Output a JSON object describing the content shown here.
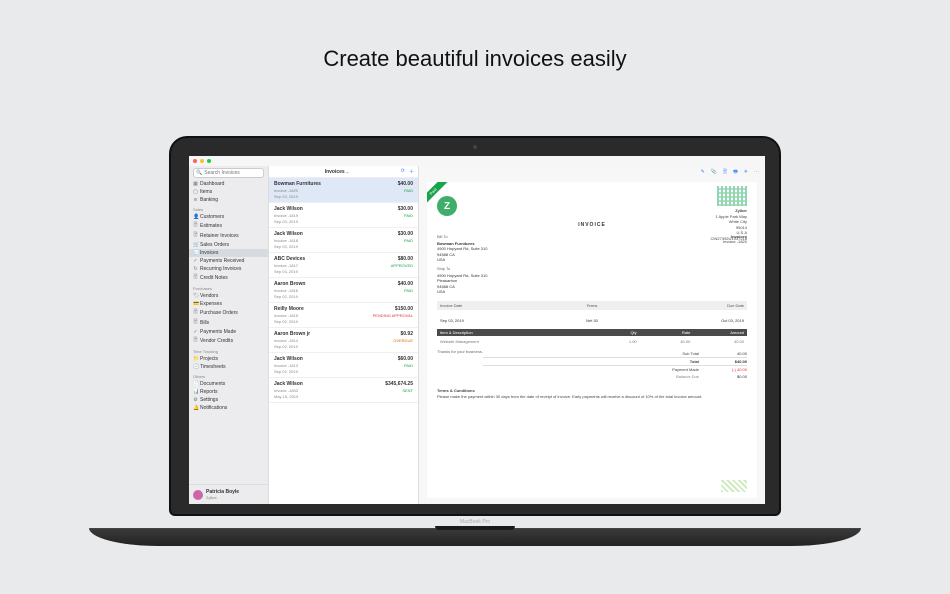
{
  "headline": "Create beautiful invoices easily",
  "laptop_label": "MacBook Pro",
  "search": {
    "placeholder": "Search Invoices"
  },
  "sidebar": {
    "top": [
      {
        "icon": "▦",
        "label": "Dashboard"
      },
      {
        "icon": "▢",
        "label": "Items"
      },
      {
        "icon": "≋",
        "label": "Banking"
      }
    ],
    "sections": [
      {
        "title": "Sales",
        "items": [
          {
            "icon": "👤",
            "label": "Customers"
          },
          {
            "icon": "🗎",
            "label": "Estimates"
          },
          {
            "icon": "🗎",
            "label": "Retainer Invoices"
          },
          {
            "icon": "🛒",
            "label": "Sales Orders"
          },
          {
            "icon": "🧾",
            "label": "Invoices",
            "active": true
          },
          {
            "icon": "✓",
            "label": "Payments Received"
          },
          {
            "icon": "↻",
            "label": "Recurring Invoices"
          },
          {
            "icon": "🗎",
            "label": "Credit Notes"
          }
        ]
      },
      {
        "title": "Purchases",
        "items": [
          {
            "icon": "🏷",
            "label": "Vendors"
          },
          {
            "icon": "💳",
            "label": "Expenses"
          },
          {
            "icon": "🗎",
            "label": "Purchase Orders"
          },
          {
            "icon": "🗎",
            "label": "Bills"
          },
          {
            "icon": "✓",
            "label": "Payments Made"
          },
          {
            "icon": "🗎",
            "label": "Vendor Credits"
          }
        ]
      },
      {
        "title": "Time Tracking",
        "items": [
          {
            "icon": "📁",
            "label": "Projects"
          },
          {
            "icon": "🕘",
            "label": "Timesheets"
          }
        ]
      },
      {
        "title": "Others",
        "items": [
          {
            "icon": "📄",
            "label": "Documents"
          },
          {
            "icon": "📊",
            "label": "Reports"
          },
          {
            "icon": "⚙",
            "label": "Settings"
          },
          {
            "icon": "🔔",
            "label": "Notifications"
          }
        ]
      }
    ],
    "profile": {
      "name": "Patricia Boyle",
      "org": "Zylker"
    }
  },
  "list": {
    "title": "Invoices",
    "rows": [
      {
        "name": "Bowman Furnitures",
        "amount": "$40.00",
        "num": "Invoice -1820",
        "status": "PAID",
        "date": "Sep 03, 2019",
        "selected": true
      },
      {
        "name": "Jack Wilson",
        "amount": "$30.00",
        "num": "Invoice -1819",
        "status": "PAID",
        "date": "Sep 03, 2019"
      },
      {
        "name": "Jack Wilson",
        "amount": "$30.00",
        "num": "Invoice -1818",
        "status": "PAID",
        "date": "Sep 03, 2019"
      },
      {
        "name": "ABC Devices",
        "amount": "$80.00",
        "num": "Invoice -1817",
        "status": "APPROVED",
        "date": "Sep 03, 2019"
      },
      {
        "name": "Aaron Brown",
        "amount": "$40.00",
        "num": "Invoice -1816",
        "status": "PAID",
        "date": "Sep 02, 2019"
      },
      {
        "name": "Reilly Moore",
        "amount": "$150.00",
        "num": "Invoice -1815",
        "status": "PENDING APPROVAL",
        "date": "Sep 02, 2019"
      },
      {
        "name": "Aaron Brown jr",
        "amount": "$0.92",
        "num": "Invoice -1814",
        "status": "OVERDUE",
        "date": "Sep 02, 2019"
      },
      {
        "name": "Jack Wilson",
        "amount": "$60.00",
        "num": "Invoice -1813",
        "status": "PAID",
        "date": "Sep 02, 2019"
      },
      {
        "name": "Jack Wilson",
        "amount": "$345,674.25",
        "num": "Invoice -1803",
        "status": "SENT",
        "date": "May 15, 2019"
      }
    ]
  },
  "invoice": {
    "ribbon": "Paid",
    "logo_letter": "Z",
    "company": {
      "name": "Zylker",
      "line1": "1 Apple Park Way",
      "line2": "White City",
      "line3": "95014",
      "line4": "U.S.A",
      "line5": "CIN27392U1937218"
    },
    "title": "INVOICE",
    "number_label": "Invoice#",
    "number": "Invoice -1820",
    "bill_label": "Bill To",
    "bill": {
      "name": "Bowman Furnitures",
      "l1": "4900 Hopyard Rd, Suite 310",
      "l2": "94588 CA",
      "l3": "USA"
    },
    "ship_label": "Ship To",
    "ship": {
      "l1": "4900 Hopyard Rd, Suite 310",
      "l2": "Pleasanton",
      "l3": "94588 CA",
      "l4": "USA"
    },
    "dates": {
      "h1": "Invoice Date",
      "h2": "Terms",
      "h3": "Due Date",
      "v1": "Sep 03, 2019",
      "v2": "Net 30",
      "v3": "Oct 03, 2019"
    },
    "cols": {
      "c1": "Item & Description",
      "c2": "Qty",
      "c3": "Rate",
      "c4": "Amount"
    },
    "line": {
      "desc": "Website Management",
      "qty": "1.00",
      "rate": "40.00",
      "amt": "40.00"
    },
    "thanks": "Thanks for your business.",
    "totals": {
      "sub_l": "Sub Total",
      "sub_v": "40.00",
      "tot_l": "Total",
      "tot_v": "$40.00",
      "pay_l": "Payment Made",
      "pay_v": "(-) 40.00",
      "bal_l": "Balance Due",
      "bal_v": "$0.00"
    },
    "terms_title": "Terms & Conditions",
    "terms_body": "Please make the payment within 30 days from the date of receipt of invoice. Early payments will receive a discount of 10% of the total invoice amount."
  }
}
